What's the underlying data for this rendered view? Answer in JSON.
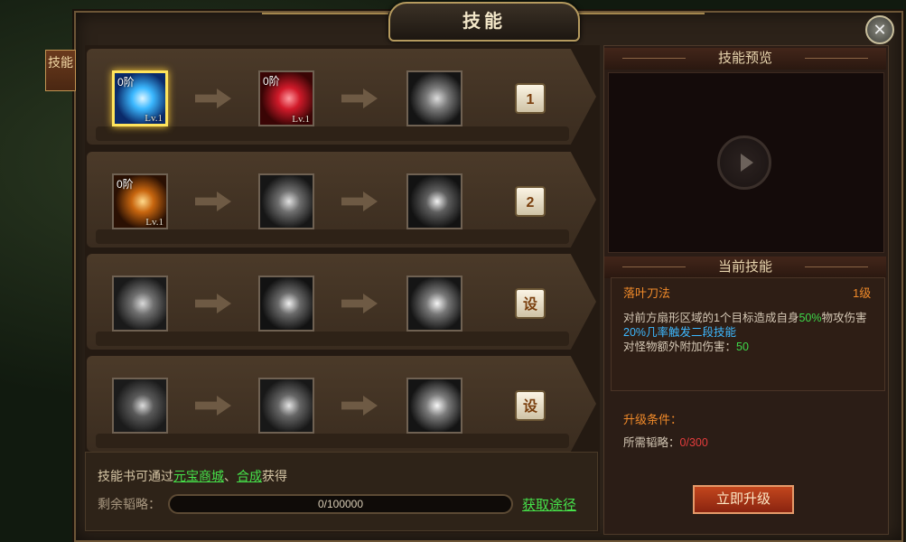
{
  "title": "技能",
  "side_tab": "技能",
  "close_label": "✕",
  "rows": [
    {
      "slots": [
        {
          "stage": "0阶",
          "lv": "Lv.1",
          "icon": "ice-slash-skill-icon",
          "colors": [
            "#0a2a6a",
            "#3bb8ff",
            "#dff6ff"
          ]
        },
        {
          "stage": "0阶",
          "lv": "Lv.1",
          "icon": "crimson-slash-skill-icon",
          "colors": [
            "#3a0505",
            "#d11a2a",
            "#ff9aa0"
          ]
        },
        {
          "stage": "",
          "lv": "",
          "icon": "vortex-slash-skill-icon",
          "colors": [
            "#141414",
            "#7a7a7a",
            "#dcdcdc"
          ]
        }
      ],
      "key": "1"
    },
    {
      "slots": [
        {
          "stage": "0阶",
          "lv": "Lv.1",
          "icon": "flame-crescent-skill-icon",
          "colors": [
            "#2a1003",
            "#c8660f",
            "#ffd98a"
          ]
        },
        {
          "stage": "",
          "lv": "",
          "icon": "shield-disc-skill-icon",
          "colors": [
            "#161616",
            "#6e6e6e",
            "#e0e0e0"
          ]
        },
        {
          "stage": "",
          "lv": "",
          "icon": "sword-burst-skill-icon",
          "colors": [
            "#121212",
            "#5e5e5e",
            "#f2f2f2"
          ]
        }
      ],
      "key": "2"
    },
    {
      "slots": [
        {
          "stage": "",
          "lv": "",
          "icon": "blade-gust-skill-icon",
          "colors": [
            "#1a1a1a",
            "#707070",
            "#d9d9d9"
          ]
        },
        {
          "stage": "",
          "lv": "",
          "icon": "lightning-slash-skill-icon",
          "colors": [
            "#121212",
            "#6a6a6a",
            "#efefef"
          ]
        },
        {
          "stage": "",
          "lv": "",
          "icon": "sword-flash-skill-icon",
          "colors": [
            "#151515",
            "#777777",
            "#f5f5f5"
          ]
        }
      ],
      "key": "设"
    },
    {
      "slots": [
        {
          "stage": "",
          "lv": "",
          "icon": "warrior-sweep-skill-icon",
          "colors": [
            "#1b1b1b",
            "#5a5a5a",
            "#dcdcdc"
          ]
        },
        {
          "stage": "",
          "lv": "",
          "icon": "warrior-charge-skill-icon",
          "colors": [
            "#181818",
            "#666666",
            "#e4e4e4"
          ]
        },
        {
          "stage": "",
          "lv": "",
          "icon": "wind-wave-skill-icon",
          "colors": [
            "#141414",
            "#7c7c7c",
            "#f7f7f7"
          ]
        }
      ],
      "key": "设"
    }
  ],
  "info": {
    "prefix": "技能书可通过",
    "link1": "元宝商城",
    "sep": "、",
    "link2": "合成",
    "suffix": "获得",
    "remain_label": "剩余韬略：",
    "progress_text": "0/100000",
    "progress": 0,
    "get_link": "获取途径"
  },
  "preview": {
    "heading": "技能预览"
  },
  "current": {
    "heading": "当前技能",
    "name": "落叶刀法",
    "level": "1级",
    "desc_a": "对前方扇形区域的1个目标造成自身",
    "desc_pct": "50%",
    "desc_b": "物攻伤害",
    "desc_trigger": "20%几率触发二段技能",
    "desc_extra": "对怪物额外附加伤害：",
    "desc_extra_val": "50"
  },
  "upgrade": {
    "cond_title": "升级条件：",
    "req_label": "所需韬略：",
    "req_val": "0/300",
    "button": "立即升级"
  }
}
